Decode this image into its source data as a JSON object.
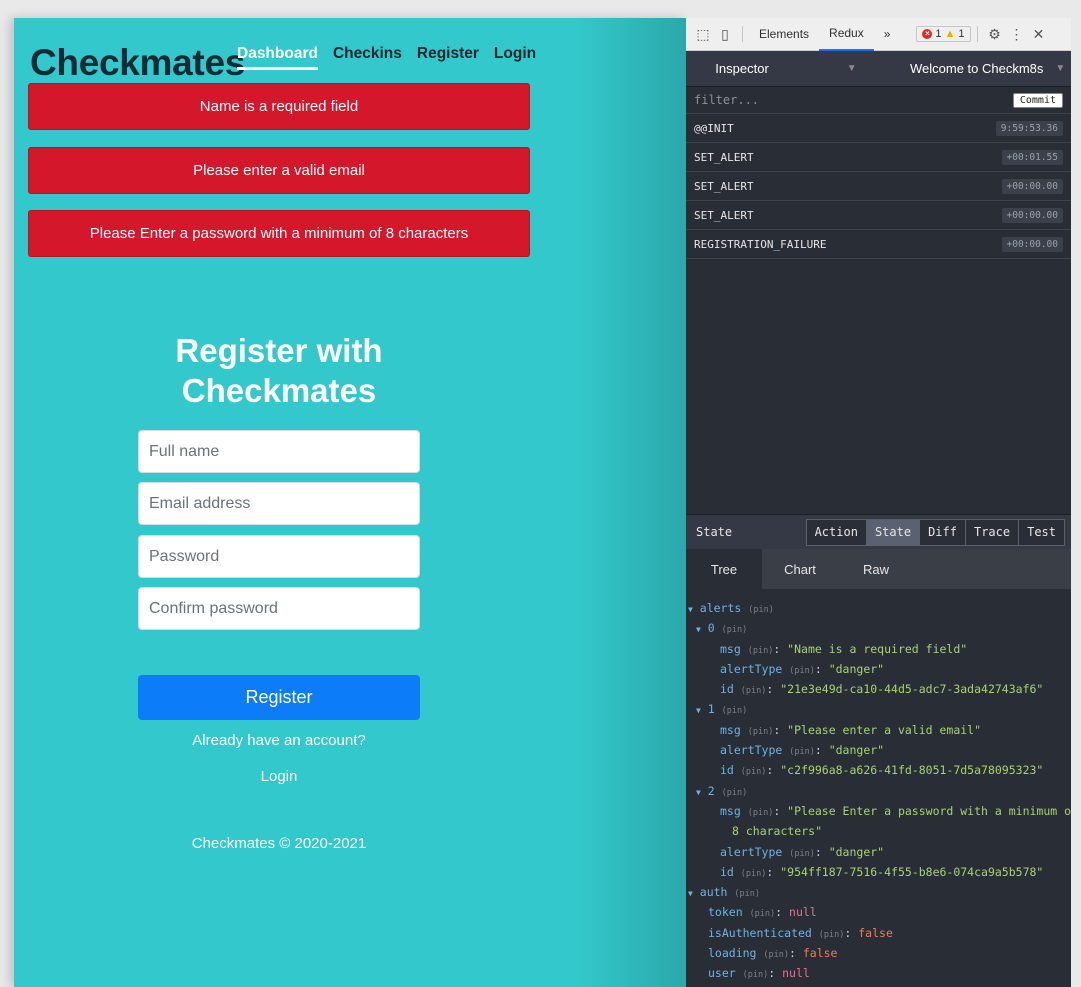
{
  "app": {
    "brand": "Checkmates",
    "nav": [
      "Dashboard",
      "Checkins",
      "Register",
      "Login"
    ],
    "alerts": [
      "Name is a required field",
      "Please enter a valid email",
      "Please Enter a password with a minimum of 8 characters"
    ],
    "form": {
      "title_line1": "Register with",
      "title_line2": "Checkmates",
      "full_name_placeholder": "Full name",
      "email_placeholder": "Email address",
      "password_placeholder": "Password",
      "confirm_placeholder": "Confirm password",
      "submit_label": "Register",
      "have_account": "Already have an account?",
      "login_link": "Login"
    },
    "footer": "Checkmates © 2020-2021",
    "colors": {
      "background": "#33c8cb",
      "alert": "#d4172a",
      "button": "#0d7cf8"
    }
  },
  "devtools": {
    "tabs": [
      "Elements",
      "Redux",
      "»"
    ],
    "active_tab": "Redux",
    "error_count": "1",
    "warning_count": "1",
    "inspector_label": "Inspector",
    "instance_label": "Welcome to Checkm8s",
    "filter_placeholder": "filter...",
    "commit_label": "Commit",
    "actions": [
      {
        "name": "@@INIT",
        "time": "9:59:53.36"
      },
      {
        "name": "SET_ALERT",
        "time": "+00:01.55"
      },
      {
        "name": "SET_ALERT",
        "time": "+00:00.00"
      },
      {
        "name": "SET_ALERT",
        "time": "+00:00.00"
      },
      {
        "name": "REGISTRATION_FAILURE",
        "time": "+00:00.00"
      }
    ],
    "state_label": "State",
    "view_buttons": [
      "Action",
      "State",
      "Diff",
      "Trace",
      "Test"
    ],
    "active_view": "State",
    "subtabs": [
      "Tree",
      "Chart",
      "Raw"
    ],
    "active_subtab": "Tree",
    "pin_label": "(pin)",
    "tree": {
      "alerts_key": "alerts",
      "items": [
        {
          "index": "0",
          "msg": "\"Name is a required field\"",
          "alertType": "\"danger\"",
          "id": "\"21e3e49d-ca10-44d5-adc7-3ada42743af6\""
        },
        {
          "index": "1",
          "msg": "\"Please enter a valid email\"",
          "alertType": "\"danger\"",
          "id": "\"c2f996a8-a626-41fd-8051-7d5a78095323\""
        },
        {
          "index": "2",
          "msg": "\"Please Enter a password with a minimum of",
          "msg_cont": "8 characters\"",
          "alertType": "\"danger\"",
          "id": "\"954ff187-7516-4f55-b8e6-074ca9a5b578\""
        }
      ],
      "auth_key": "auth",
      "auth": {
        "token": "null",
        "isAuthenticated": "false",
        "loading": "false",
        "user": "null"
      }
    }
  }
}
